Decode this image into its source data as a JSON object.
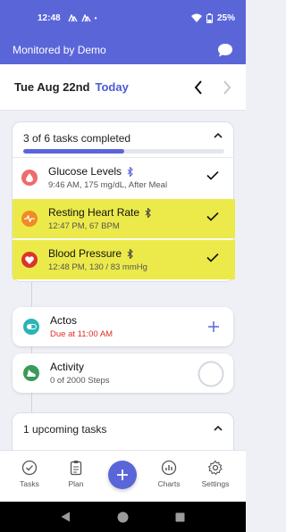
{
  "status_bar": {
    "time": "12:48",
    "battery": "25%"
  },
  "header": {
    "title": "Monitored by Demo",
    "chat_icon": "chat-bubble-icon"
  },
  "date_bar": {
    "date": "Tue Aug 22nd",
    "today_label": "Today"
  },
  "progress": {
    "summary": "3 of 6 tasks completed",
    "completed": 3,
    "total": 6
  },
  "tasks": [
    {
      "name": "Glucose Levels",
      "detail": "9:46 AM, 175 mg/dL, After Meal",
      "icon": "blood-drop-icon",
      "icon_bg": "#ef6b6b",
      "highlight": false,
      "bt_color": "#5a66d8"
    },
    {
      "name": "Resting Heart Rate",
      "detail": "12:47 PM, 67 BPM",
      "icon": "heart-pulse-icon",
      "icon_bg": "#f08a24",
      "highlight": true,
      "bt_color": "#444444"
    },
    {
      "name": "Blood Pressure",
      "detail": "12:48 PM, 130 / 83 mmHg",
      "icon": "heart-icon",
      "icon_bg": "#d9352b",
      "highlight": true,
      "bt_color": "#444444"
    }
  ],
  "medication": {
    "name": "Actos",
    "detail": "Due at 11:00 AM",
    "detail_color": "#d93025",
    "icon": "pill-icon",
    "icon_bg": "#2bb5b5"
  },
  "activity": {
    "name": "Activity",
    "detail": "0 of 2000 Steps",
    "icon": "shoe-icon",
    "icon_bg": "#3a9a5a"
  },
  "upcoming": {
    "label": "1 upcoming tasks"
  },
  "tabs": [
    {
      "label": "Tasks",
      "icon": "check-circle-icon"
    },
    {
      "label": "Plan",
      "icon": "clipboard-icon"
    },
    {
      "label": "Charts",
      "icon": "bar-chart-icon"
    },
    {
      "label": "Settings",
      "icon": "gear-icon"
    }
  ],
  "colors": {
    "primary": "#5a66d8",
    "highlight": "#ecea4a"
  }
}
